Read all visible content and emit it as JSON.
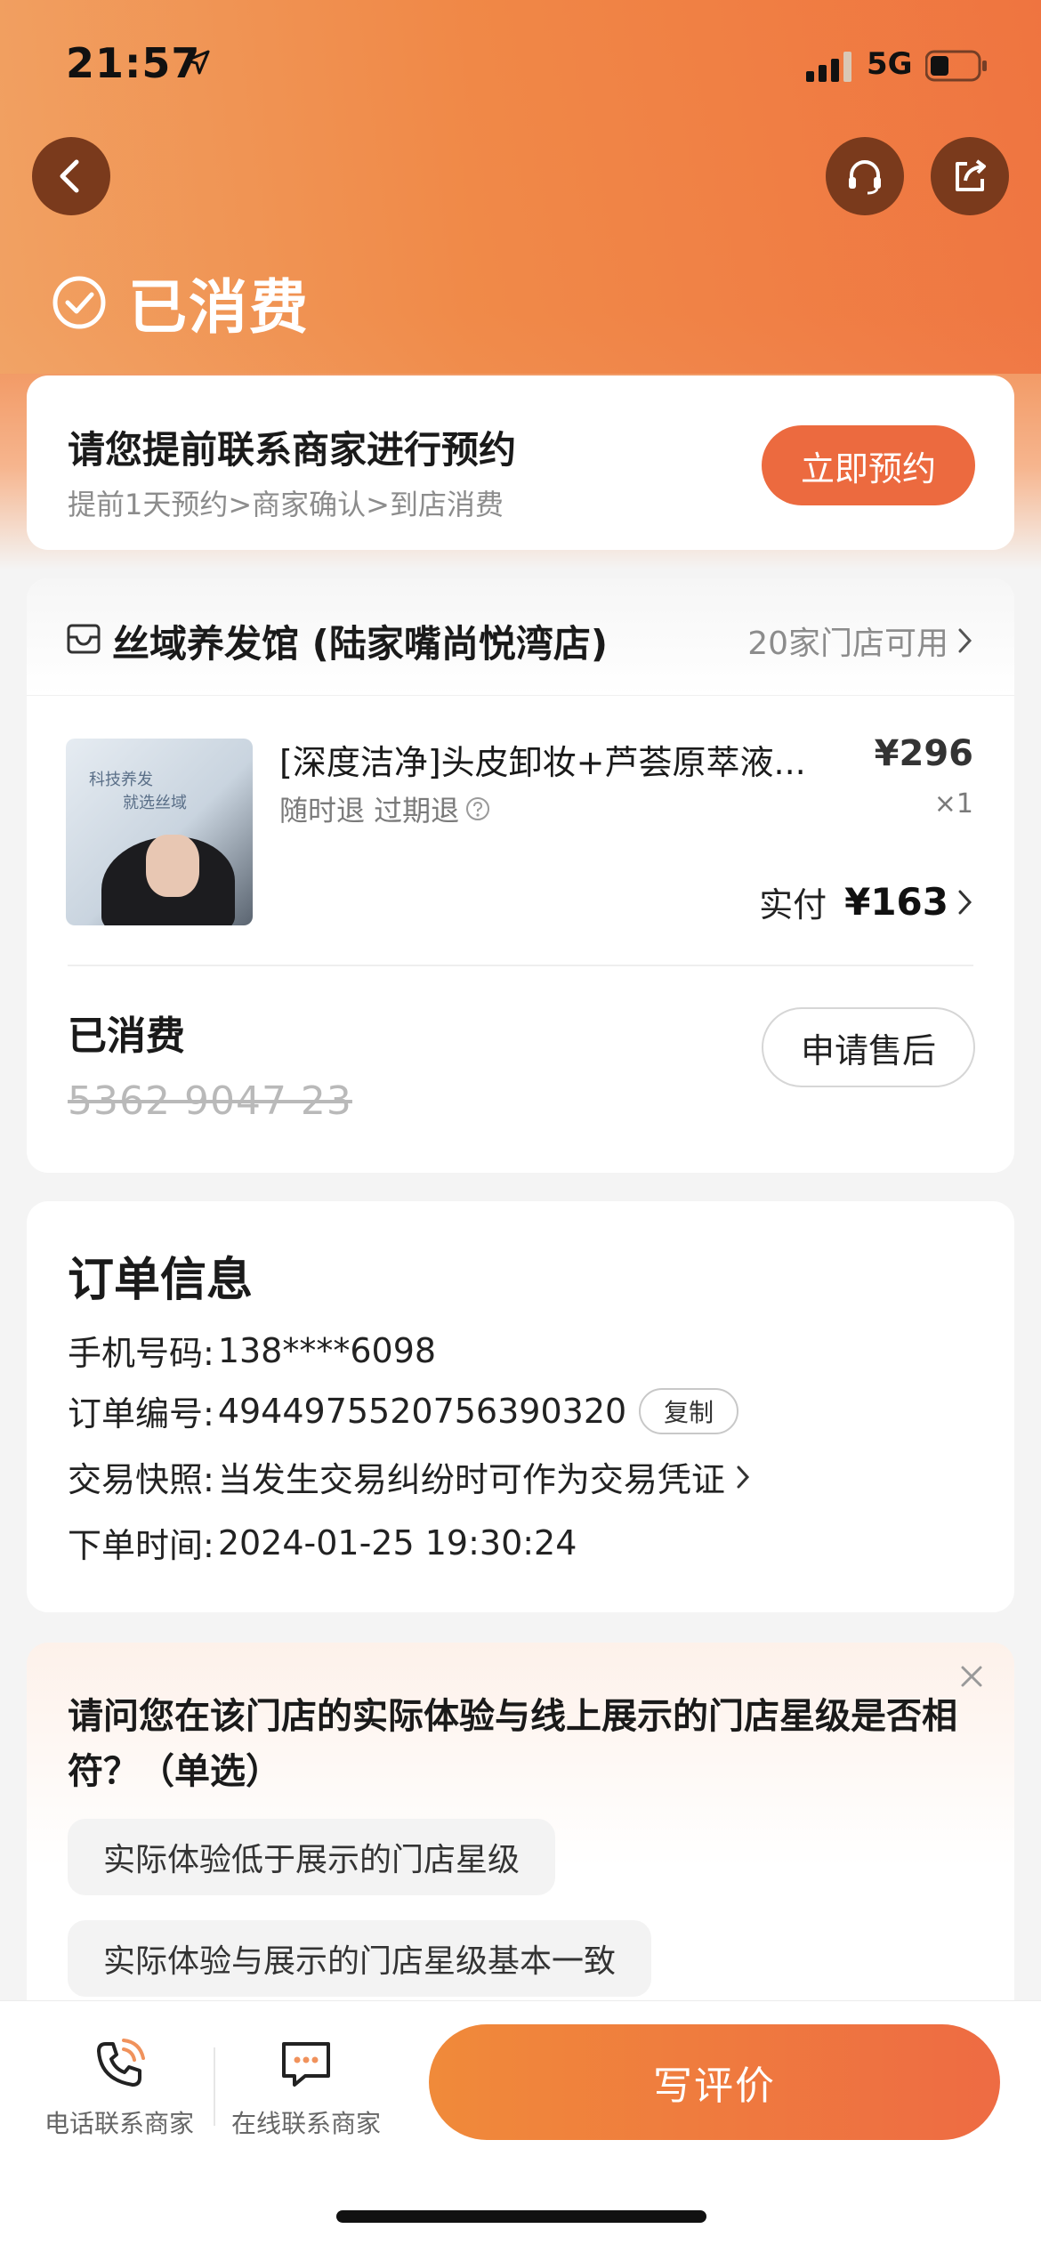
{
  "status_bar": {
    "time": "21:57",
    "network": "5G"
  },
  "header": {
    "order_status": "已消费",
    "icons": {
      "back": "chevron-left-icon",
      "service": "headset-icon",
      "share": "share-icon"
    }
  },
  "appointment": {
    "title": "请您提前联系商家进行预约",
    "subtitle": "提前1天预约>商家确认>到店消费",
    "button": "立即预约"
  },
  "store": {
    "name": "丝域养发馆 (陆家嘴尚悦湾店)",
    "availability": "20家门店可用"
  },
  "product": {
    "image_caption_line1": "科技养发",
    "image_caption_line2": "就选丝域",
    "name": "[深度洁净]头皮卸妆+芦荟原萃液...",
    "tags": "随时退 过期退",
    "price": "¥296",
    "quantity": "×1",
    "paid_label": "实付",
    "paid_amount": "¥163"
  },
  "voucher": {
    "status": "已消费",
    "code": "5362 9047 23",
    "aftersale_button": "申请售后"
  },
  "order_info": {
    "title": "订单信息",
    "phone_label": "手机号码:",
    "phone_value": "138****6098",
    "order_no_label": "订单编号:",
    "order_no_value": "4944975520756390320",
    "copy_button": "复制",
    "snapshot_label": "交易快照:",
    "snapshot_value": "当发生交易纠纷时可作为交易凭证",
    "time_label": "下单时间:",
    "time_value": "2024-01-25 19:30:24"
  },
  "survey": {
    "question": "请问您在该门店的实际体验与线上展示的门店星级是否相符？（单选）",
    "options": [
      "实际体验低于展示的门店星级",
      "实际体验与展示的门店星级基本一致"
    ]
  },
  "bottom_bar": {
    "phone_contact": "电话联系商家",
    "online_contact": "在线联系商家",
    "review_button": "写评价"
  },
  "colors": {
    "accent": "#ec6a3f",
    "header_gradient_start": "#f1a566",
    "header_gradient_end": "#ef7340"
  }
}
